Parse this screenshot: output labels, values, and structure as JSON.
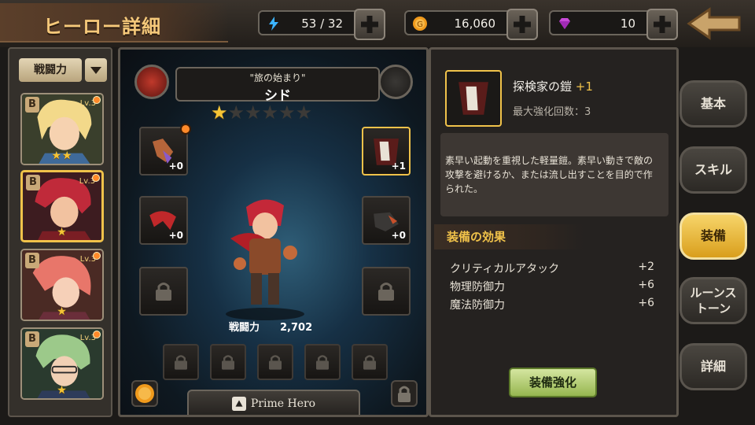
{
  "header": {
    "title": "ヒーロー詳細",
    "stamina": "53 / 32",
    "gold": "16,060",
    "gems": "10",
    "back_icon": "back-arrow-icon"
  },
  "hero_list": {
    "sort_label": "戦闘力",
    "heroes": [
      {
        "rank": "B",
        "level": "Lv.3",
        "stars": "★★"
      },
      {
        "rank": "B",
        "level": "Lv.3",
        "stars": "★"
      },
      {
        "rank": "B",
        "level": "Lv.3",
        "stars": "★"
      },
      {
        "rank": "B",
        "level": "Lv.3",
        "stars": "★"
      }
    ]
  },
  "hero": {
    "subtitle": "\"旅の始まり\"",
    "name": "シド",
    "stars_on": "★",
    "stars_off": "★★★★★",
    "power_label": "戦闘力",
    "power_value": "2,702",
    "equipment": {
      "weapon_plus": "+0",
      "armor_plus": "+1",
      "cape_plus": "+0",
      "boots_plus": "+0"
    },
    "prime_label": "Prime Hero"
  },
  "item": {
    "name": "探検家の鎧",
    "enhance": "+1",
    "max_enhance": "最大強化回数：3",
    "description": "素早い起動を重視した軽量鎧。素早い動きで敵の攻撃を避けるか、または流し出すことを目的で作られた。",
    "effects_title": "装備の効果",
    "effects": [
      {
        "label": "クリティカルアタック",
        "value": "+2"
      },
      {
        "label": "物理防御力",
        "value": "+6"
      },
      {
        "label": "魔法防御力",
        "value": "+6"
      }
    ],
    "enhance_button": "装備強化"
  },
  "tabs": {
    "basic": "基本",
    "skill": "スキル",
    "equip": "装備",
    "rune": "ルーンストーン",
    "detail": "詳細"
  },
  "colors": {
    "accent_gold": "#f0c24a",
    "active_tab": "#f7d56a",
    "enhance_green": "#96b650"
  }
}
